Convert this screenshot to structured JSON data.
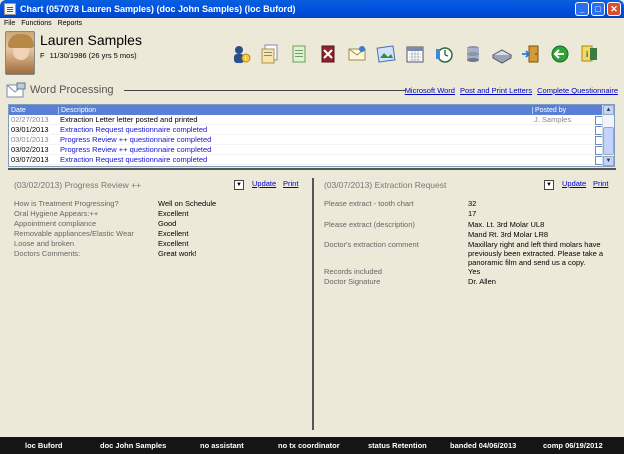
{
  "window": {
    "title": "Chart (057078  Lauren Samples) (doc John Samples) (loc Buford)",
    "controls": [
      "minimize",
      "maximize",
      "close"
    ]
  },
  "menu": [
    "File",
    "Functions",
    "Reports"
  ],
  "patient": {
    "name": "Lauren Samples",
    "sex": "F",
    "dob": "11/30/1986 (26 yrs 5 mos)"
  },
  "toolbar_icons": [
    "person-info-icon",
    "documents-icon",
    "notes-icon",
    "delete-icon",
    "letter-icon",
    "image-icon",
    "calendar-icon",
    "timer-icon",
    "database-icon",
    "scanner-icon",
    "door-exit-icon",
    "back-arrow-icon",
    "help-icon"
  ],
  "word_processing": {
    "title": "Word Processing",
    "links": [
      "Microsoft Word",
      "Post and Print Letters",
      "Complete Questionnaire"
    ]
  },
  "grid": {
    "headers": [
      "Date",
      "Description",
      "Posted by"
    ],
    "rows": [
      {
        "date": "02/27/2013",
        "desc": "Extraction Letter letter posted and printed",
        "by": "J. Samples",
        "date_style": "gray",
        "desc_style": "black"
      },
      {
        "date": "03/01/2013",
        "desc": "Extraction Request questionnaire completed",
        "by": "",
        "date_style": "black",
        "desc_style": "blue"
      },
      {
        "date": "03/01/2013",
        "desc": "Progress Review ++ questionnaire completed",
        "by": "",
        "date_style": "gray",
        "desc_style": "blue"
      },
      {
        "date": "03/02/2013",
        "desc": "Progress Review ++ questionnaire completed",
        "by": "",
        "date_style": "black",
        "desc_style": "blue"
      },
      {
        "date": "03/07/2013",
        "desc": "Extraction Request questionnaire completed",
        "by": "",
        "date_style": "black",
        "desc_style": "blue"
      }
    ]
  },
  "left_panel": {
    "title": "(03/02/2013)  Progress Review ++",
    "update": "Update",
    "print": "Print",
    "fields": [
      {
        "label": "How is Treatment Progressing?",
        "value": "Well on Schedule"
      },
      {
        "label": "Oral Hygiene Appears:++",
        "value": "Excellent"
      },
      {
        "label": "Appointment compliance",
        "value": "Good"
      },
      {
        "label": "Removable appliances/Elastic Wear",
        "value": "Excellent"
      },
      {
        "label": "Loose and broken",
        "value": "Excellent"
      },
      {
        "label": "Doctors Comments:",
        "value": "Great work!"
      }
    ]
  },
  "right_panel": {
    "title": "(03/07/2013)  Extraction Request",
    "update": "Update",
    "print": "Print",
    "fields": [
      {
        "label": "Please extract - tooth chart",
        "value": "32"
      },
      {
        "label": "",
        "value": "17"
      },
      {
        "label": "Please extract (description)",
        "value": "Max. Lt. 3rd Molar UL8"
      },
      {
        "label": "",
        "value": "Mand Rt. 3rd Molar LR8"
      },
      {
        "label": "Doctor's extraction comment",
        "value": "Maxillary right and left third molars have"
      },
      {
        "label": "",
        "value": "previously been extracted.  Please take a"
      },
      {
        "label": "",
        "value": "panoramic film and send us a copy."
      },
      {
        "label": "Records included",
        "value": "Yes"
      },
      {
        "label": "Doctor Signature",
        "value": "Dr. Allen"
      }
    ]
  },
  "status": {
    "loc": "loc Buford",
    "doc": "doc John Samples",
    "assistant": "no assistant",
    "tx": "no tx coordinator",
    "status": "status Retention",
    "banded": "banded 04/06/2013",
    "comp": "comp 06/19/2012"
  }
}
